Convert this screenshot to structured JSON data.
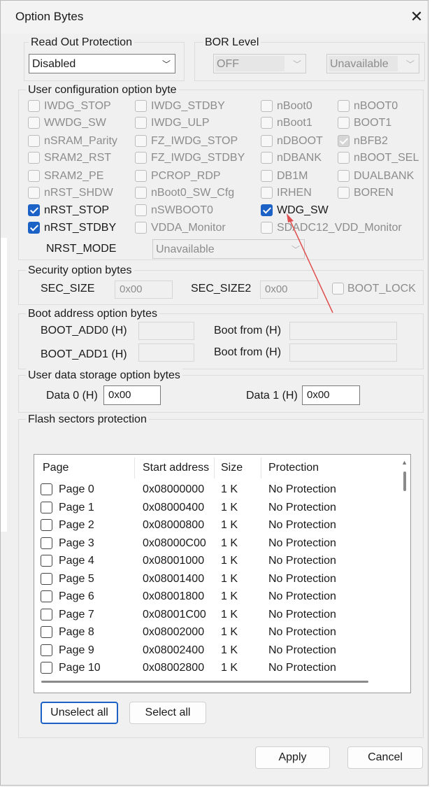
{
  "window": {
    "title": "Option Bytes",
    "close_glyph": "✕"
  },
  "read_out": {
    "label": "Read Out Protection",
    "value": "Disabled"
  },
  "bor": {
    "label": "BOR Level",
    "value": "OFF",
    "extra_value": "Unavailable"
  },
  "user_config": {
    "label": "User configuration option byte",
    "checkboxes": [
      {
        "label": "IWDG_STOP",
        "checked": false,
        "enabled": false
      },
      {
        "label": "IWDG_STDBY",
        "checked": false,
        "enabled": false
      },
      {
        "label": "nBoot0",
        "checked": false,
        "enabled": false
      },
      {
        "label": "nBOOT0",
        "checked": false,
        "enabled": false
      },
      {
        "label": "WWDG_SW",
        "checked": false,
        "enabled": false
      },
      {
        "label": "IWDG_ULP",
        "checked": false,
        "enabled": false
      },
      {
        "label": "nBoot1",
        "checked": false,
        "enabled": false
      },
      {
        "label": "BOOT1",
        "checked": false,
        "enabled": false
      },
      {
        "label": "nSRAM_Parity",
        "checked": false,
        "enabled": false
      },
      {
        "label": "FZ_IWDG_STOP",
        "checked": false,
        "enabled": false
      },
      {
        "label": "nDBOOT",
        "checked": false,
        "enabled": false
      },
      {
        "label": "nBFB2",
        "checked": true,
        "enabled": false
      },
      {
        "label": "SRAM2_RST",
        "checked": false,
        "enabled": false
      },
      {
        "label": "FZ_IWDG_STDBY",
        "checked": false,
        "enabled": false
      },
      {
        "label": "nDBANK",
        "checked": false,
        "enabled": false
      },
      {
        "label": "nBOOT_SEL",
        "checked": false,
        "enabled": false
      },
      {
        "label": "SRAM2_PE",
        "checked": false,
        "enabled": false
      },
      {
        "label": "PCROP_RDP",
        "checked": false,
        "enabled": false
      },
      {
        "label": "DB1M",
        "checked": false,
        "enabled": false
      },
      {
        "label": "DUALBANK",
        "checked": false,
        "enabled": false
      },
      {
        "label": "nRST_SHDW",
        "checked": false,
        "enabled": false
      },
      {
        "label": "nBoot0_SW_Cfg",
        "checked": false,
        "enabled": false
      },
      {
        "label": "IRHEN",
        "checked": false,
        "enabled": false
      },
      {
        "label": "BOREN",
        "checked": false,
        "enabled": false
      },
      {
        "label": "nRST_STOP",
        "checked": true,
        "enabled": true
      },
      {
        "label": "nSWBOOT0",
        "checked": false,
        "enabled": false
      },
      {
        "label": "WDG_SW",
        "checked": true,
        "enabled": true
      },
      {
        "label": "nRST_STDBY",
        "checked": true,
        "enabled": true
      },
      {
        "label": "VDDA_Monitor",
        "checked": false,
        "enabled": false
      },
      {
        "label": "SDADC12_VDD_Monitor",
        "checked": false,
        "enabled": false
      }
    ],
    "nrst_mode_label": "NRST_MODE",
    "nrst_mode_value": "Unavailable"
  },
  "security": {
    "label": "Security option bytes",
    "sec_size_label": "SEC_SIZE",
    "sec_size_value": "0x00",
    "sec_size2_label": "SEC_SIZE2",
    "sec_size2_value": "0x00",
    "boot_lock_label": "BOOT_LOCK"
  },
  "boot_address": {
    "label": "Boot address option bytes",
    "add0_label": "BOOT_ADD0 (H)",
    "add1_label": "BOOT_ADD1 (H)",
    "from0_label": "Boot from (H)",
    "from1_label": "Boot from (H)"
  },
  "user_data": {
    "label": "User data storage option bytes",
    "data0_label": "Data 0 (H)",
    "data0_value": "0x00",
    "data1_label": "Data 1 (H)",
    "data1_value": "0x00"
  },
  "flash": {
    "label": "Flash sectors protection",
    "columns": [
      "Page",
      "Start address",
      "Size",
      "Protection"
    ],
    "rows": [
      {
        "page": "Page 0",
        "addr": "0x08000000",
        "size": "1 K",
        "prot": "No Protection"
      },
      {
        "page": "Page 1",
        "addr": "0x08000400",
        "size": "1 K",
        "prot": "No Protection"
      },
      {
        "page": "Page 2",
        "addr": "0x08000800",
        "size": "1 K",
        "prot": "No Protection"
      },
      {
        "page": "Page 3",
        "addr": "0x08000C00",
        "size": "1 K",
        "prot": "No Protection"
      },
      {
        "page": "Page 4",
        "addr": "0x08001000",
        "size": "1 K",
        "prot": "No Protection"
      },
      {
        "page": "Page 5",
        "addr": "0x08001400",
        "size": "1 K",
        "prot": "No Protection"
      },
      {
        "page": "Page 6",
        "addr": "0x08001800",
        "size": "1 K",
        "prot": "No Protection"
      },
      {
        "page": "Page 7",
        "addr": "0x08001C00",
        "size": "1 K",
        "prot": "No Protection"
      },
      {
        "page": "Page 8",
        "addr": "0x08002000",
        "size": "1 K",
        "prot": "No Protection"
      },
      {
        "page": "Page 9",
        "addr": "0x08002400",
        "size": "1 K",
        "prot": "No Protection"
      },
      {
        "page": "Page 10",
        "addr": "0x08002800",
        "size": "1 K",
        "prot": "No Protection"
      }
    ],
    "unselect_all": "Unselect all",
    "select_all": "Select all"
  },
  "footer": {
    "apply": "Apply",
    "cancel": "Cancel"
  },
  "colors": {
    "accent": "#1c61c6",
    "annotation": "#e05050"
  },
  "icons": {
    "close": "close-icon",
    "dropdown": "chevron-down-icon",
    "check": "check-icon"
  }
}
